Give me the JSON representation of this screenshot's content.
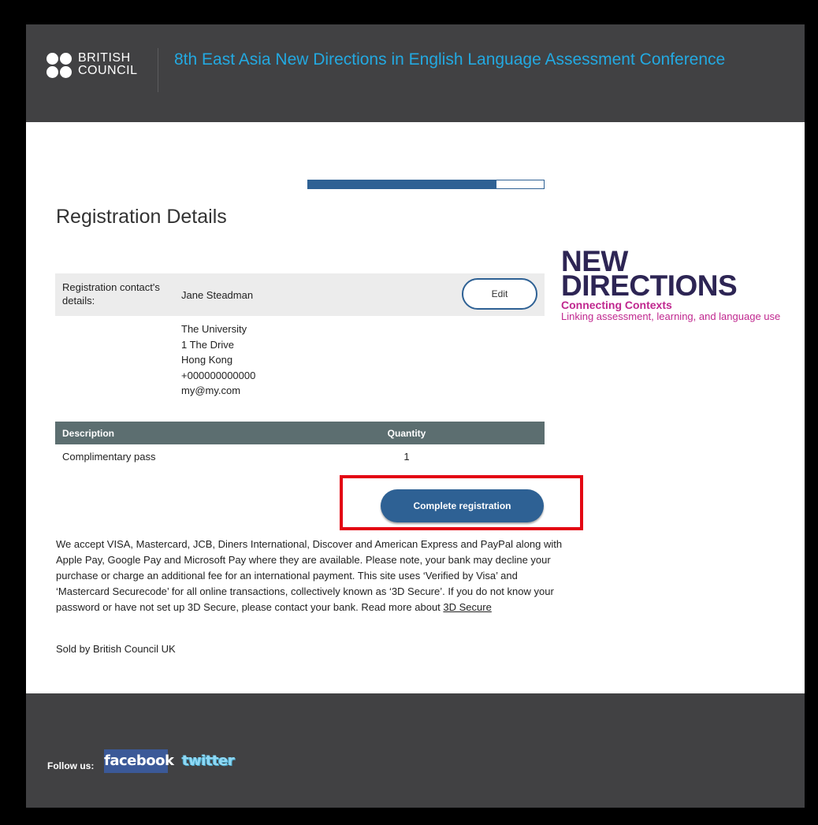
{
  "header": {
    "logo_lines": [
      "BRITISH",
      "COUNCIL"
    ],
    "conference_title": "8th East Asia New Directions in English Language Assessment Conference"
  },
  "progress": {
    "fraction": 0.8
  },
  "page_title": "Registration Details",
  "contact": {
    "label": "Registration contact's details:",
    "name": "Jane Steadman",
    "edit_label": "Edit",
    "address_lines": [
      "The University",
      "1 The Drive",
      "Hong Kong",
      "+000000000000",
      "my@my.com"
    ]
  },
  "table": {
    "headers": {
      "description": "Description",
      "quantity": "Quantity"
    },
    "rows": [
      {
        "description": "Complimentary pass",
        "quantity": "1"
      }
    ]
  },
  "complete_button_label": "Complete registration",
  "payment": {
    "text": "We accept VISA, Mastercard, JCB, Diners International, Discover and American Express and PayPal along with Apple Pay, Google Pay and Microsoft Pay where they are available. Please note, your bank may decline your purchase or charge an additional fee for an international payment. This site uses ‘Verified by Visa’ and ‘Mastercard Securecode’ for all online transactions, collectively known as ‘3D Secure’. If you do not know your password or have not set up 3D Secure, please contact your bank. Read more about ",
    "link_label": "3D Secure"
  },
  "sold_by": "Sold by British Council UK",
  "side_logo": {
    "line1": "NEW",
    "line2": "DIRECTIONS",
    "tagline": "Connecting Contexts",
    "subtitle": "Linking assessment, learning, and language use"
  },
  "footer": {
    "follow_label": "Follow us:",
    "facebook_label": "facebook",
    "twitter_label": "twitter"
  },
  "colors": {
    "header_bg": "#414143",
    "title_blue": "#23a9e1",
    "primary": "#2e6194",
    "table_header": "#5c6e70",
    "highlight": "#e30613",
    "nd_navy": "#2d2554",
    "nd_magenta": "#c0288f"
  }
}
